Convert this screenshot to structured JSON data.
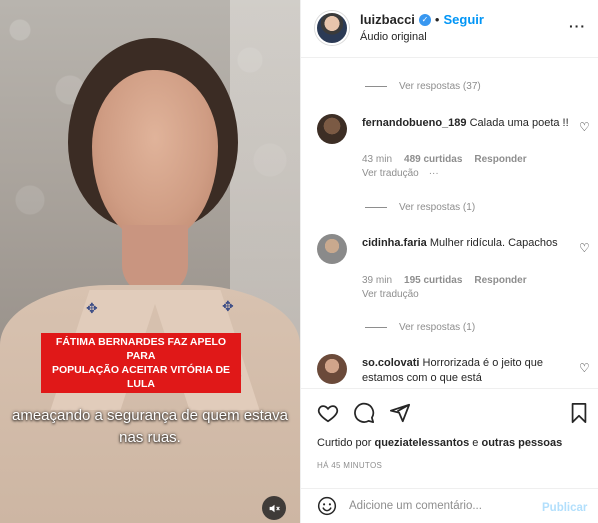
{
  "video": {
    "headline_line1": "FÁTIMA BERNARDES FAZ APELO PARA",
    "headline_line2": "POPULAÇÃO ACEITAR VITÓRIA DE LULA",
    "subtitle_line1": "ameaçando a segurança de quem estava",
    "subtitle_line2": "nas ruas.",
    "mute_icon": "speaker-muted-icon"
  },
  "header": {
    "username": "luizbacci",
    "follow_label": "Seguir",
    "separator": "•",
    "audio_label": "Áudio original",
    "more_label": "···"
  },
  "comments": {
    "view_replies_1": "Ver respostas (37)",
    "view_replies_2": "Ver respostas (1)",
    "view_replies_3": "Ver respostas (1)",
    "items": [
      {
        "username": "fernandobueno_189",
        "text": "Calada uma poeta !!",
        "time": "43 min",
        "likes": "489 curtidas",
        "reply": "Responder",
        "translate": "Ver tradução",
        "more": "···"
      },
      {
        "username": "cidinha.faria",
        "text": "Mulher ridícula. Capachos",
        "time": "39 min",
        "likes": "195 curtidas",
        "reply": "Responder",
        "translate": "Ver tradução"
      },
      {
        "username": "so.colovati",
        "text": "Horrorizada é o jeito que estamos com o que está"
      }
    ]
  },
  "actions": {
    "liked_prefix": "Curtido por ",
    "liked_user": "queziatelessantos",
    "liked_connector": " e ",
    "liked_others": "outras pessoas",
    "time_ago": "HÁ 45 MINUTOS"
  },
  "add_comment": {
    "placeholder": "Adicione um comentário...",
    "publish_label": "Publicar"
  },
  "colors": {
    "accent": "#0095f6",
    "headline_bg": "#e01818",
    "verified": "#3897f0"
  }
}
